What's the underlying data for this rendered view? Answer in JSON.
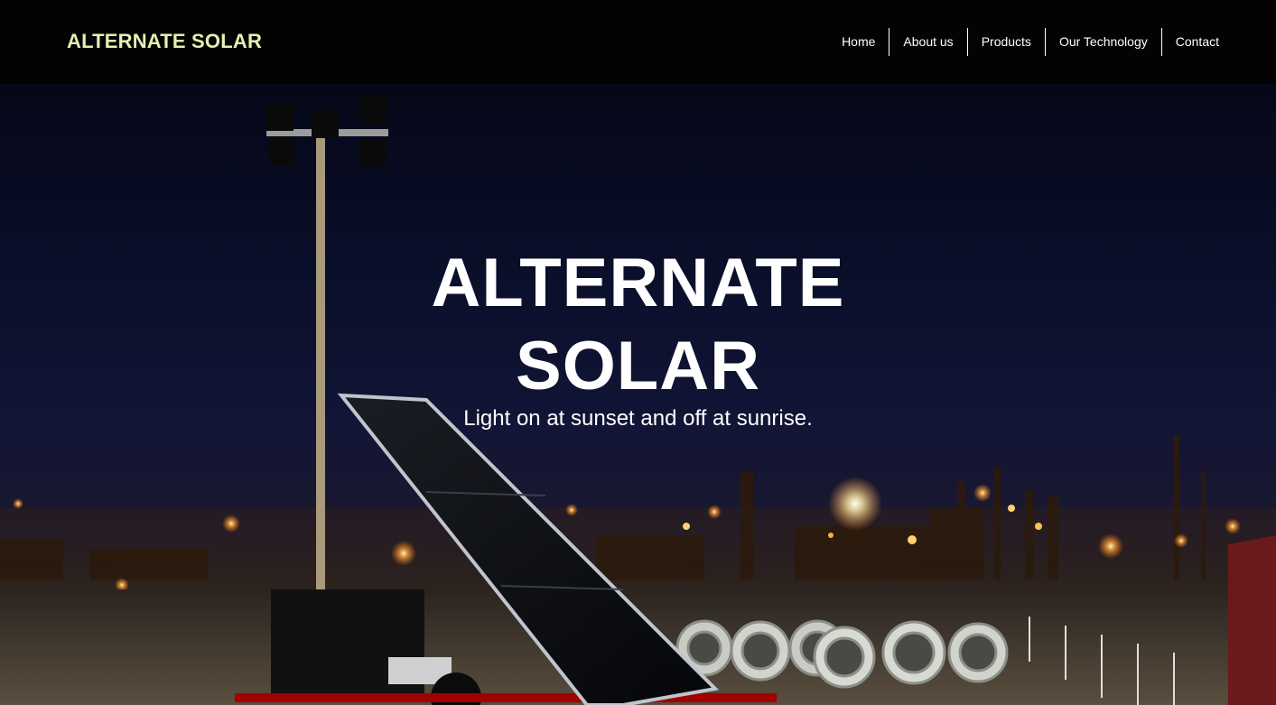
{
  "header": {
    "brand": "ALTERNATE SOLAR",
    "brand_color": "#e6f0b0",
    "nav": [
      {
        "label": "Home"
      },
      {
        "label": "About us"
      },
      {
        "label": "Products"
      },
      {
        "label": "Our Technology"
      },
      {
        "label": "Contact"
      }
    ]
  },
  "hero": {
    "title_line1": "ALTERNATE",
    "title_line2": "SOLAR",
    "subtitle": "Light on at sunset and off at sunrise.",
    "background_image": "night-industrial-site-solar-light-tower"
  }
}
